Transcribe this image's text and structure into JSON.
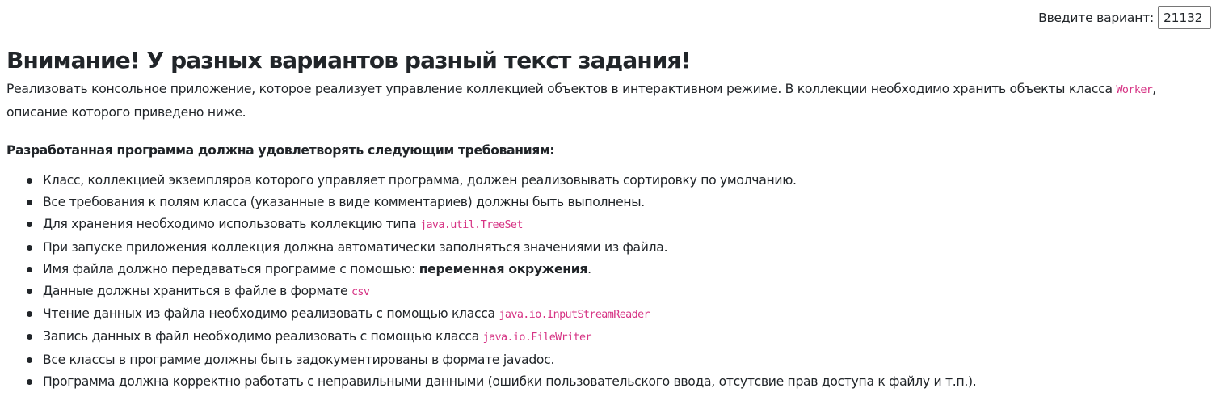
{
  "variant": {
    "label": "Введите вариант:",
    "value": "21132"
  },
  "title": "Внимание! У разных вариантов разный текст задания!",
  "intro": {
    "text_before": "Реализовать консольное приложение, которое реализует управление коллекцией объектов в интерактивном режиме. В коллекции необходимо хранить объекты класса ",
    "class_name": "Worker",
    "text_after": ", описание которого приведено ниже."
  },
  "requirements_title": "Разработанная программа должна удовлетворять следующим требованиям:",
  "requirements": [
    {
      "text": "Класс, коллекцией экземпляров которого управляет программа, должен реализовывать сортировку по умолчанию."
    },
    {
      "text": "Все требования к полям класса (указанные в виде комментариев) должны быть выполнены."
    },
    {
      "text": "Для хранения необходимо использовать коллекцию типа ",
      "code": "java.util.TreeSet"
    },
    {
      "text": "При запуске приложения коллекция должна автоматически заполняться значениями из файла."
    },
    {
      "text": "Имя файла должно передаваться программе с помощью: ",
      "bold": "переменная окружения",
      "after": "."
    },
    {
      "text": "Данные должны храниться в файле в формате ",
      "code": "csv"
    },
    {
      "text": "Чтение данных из файла необходимо реализовать с помощью класса ",
      "code": "java.io.InputStreamReader"
    },
    {
      "text": "Запись данных в файл необходимо реализовать с помощью класса ",
      "code": "java.io.FileWriter"
    },
    {
      "text": "Все классы в программе должны быть задокументированы в формате javadoc."
    },
    {
      "text": "Программа должна корректно работать с неправильными данными (ошибки пользовательского ввода, отсутсвие прав доступа к файлу и т.п.)."
    }
  ],
  "colors": {
    "text": "#212529",
    "code": "#d63384",
    "background": "#ffffff"
  }
}
